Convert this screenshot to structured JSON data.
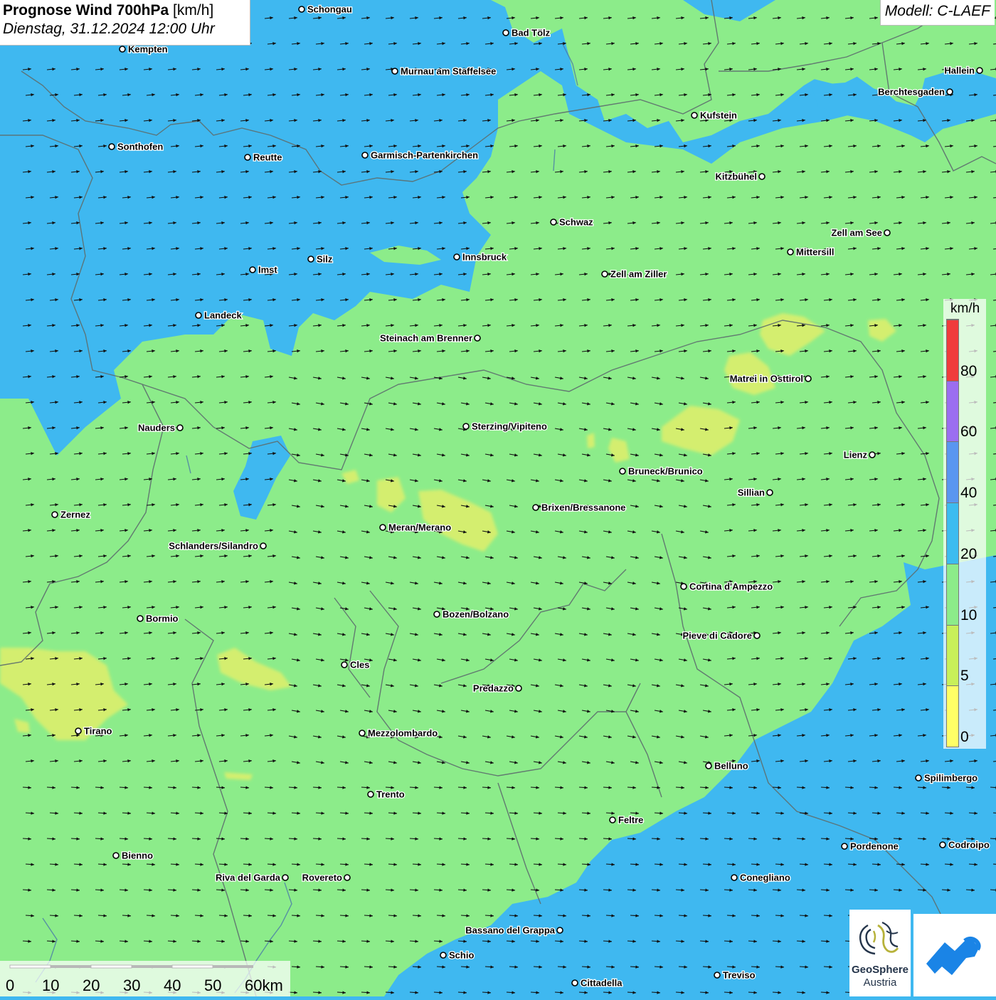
{
  "header": {
    "title_main": "Prognose Wind 700hPa",
    "title_unit": "[km/h]",
    "subtitle": "Dienstag, 31.12.2024 12:00 Uhr",
    "model": "Modell: C-LAEF"
  },
  "legend": {
    "unit": "km/h",
    "labels": [
      "0",
      "5",
      "10",
      "20",
      "40",
      "60",
      "80"
    ],
    "bins": [
      {
        "color": "#ffff66"
      },
      {
        "color": "#c8f05a"
      },
      {
        "color": "#8cec8a"
      },
      {
        "color": "#3cbcf0"
      },
      {
        "color": "#5a96f0"
      },
      {
        "color": "#9b6ef0"
      },
      {
        "color": "#f03c3c"
      }
    ]
  },
  "scalebar": {
    "labels": [
      "0",
      "10",
      "20",
      "30",
      "40",
      "50",
      "60km"
    ]
  },
  "map": {
    "colors": {
      "green": "#8cec8a",
      "blue": "#3fb8f0",
      "yellow": "#d8ef6e",
      "arrow": "#111111",
      "border": "#5d6e6e"
    },
    "wind_direction": "east",
    "cities": [
      {
        "name": "Schongau",
        "side": "right"
      },
      {
        "name": "Bad Tölz",
        "side": "right"
      },
      {
        "name": "Kempten",
        "side": "right"
      },
      {
        "name": "Murnau am Staffelsee",
        "side": "right"
      },
      {
        "name": "Hallein",
        "side": "left"
      },
      {
        "name": "Berchtesgaden",
        "side": "left"
      },
      {
        "name": "Kufstein",
        "side": "right"
      },
      {
        "name": "Sonthofen",
        "side": "right"
      },
      {
        "name": "Reutte",
        "side": "right"
      },
      {
        "name": "Garmisch-Partenkirchen",
        "side": "right"
      },
      {
        "name": "Kitzbühel",
        "side": "left"
      },
      {
        "name": "Schwaz",
        "side": "right"
      },
      {
        "name": "Zell am See",
        "side": "left"
      },
      {
        "name": "Mittersill",
        "side": "right"
      },
      {
        "name": "Innsbruck",
        "side": "right"
      },
      {
        "name": "Silz",
        "side": "right"
      },
      {
        "name": "Imst",
        "side": "right"
      },
      {
        "name": "Zell am Ziller",
        "side": "right"
      },
      {
        "name": "Landeck",
        "side": "right"
      },
      {
        "name": "Steinach am Brenner",
        "side": "left"
      },
      {
        "name": "Matrei in Osttirol",
        "side": "left"
      },
      {
        "name": "Nauders",
        "side": "left"
      },
      {
        "name": "Sterzing/Vipiteno",
        "side": "right"
      },
      {
        "name": "Lienz",
        "side": "left"
      },
      {
        "name": "Bruneck/Brunico",
        "side": "right"
      },
      {
        "name": "Sillian",
        "side": "left"
      },
      {
        "name": "Brixen/Bressanone",
        "side": "right"
      },
      {
        "name": "Zernez",
        "side": "right"
      },
      {
        "name": "Meran/Merano",
        "side": "right"
      },
      {
        "name": "Schlanders/Silandro",
        "side": "left"
      },
      {
        "name": "Cortina d'Ampezzo",
        "side": "right"
      },
      {
        "name": "Bozen/Bolzano",
        "side": "right"
      },
      {
        "name": "Bormio",
        "side": "right"
      },
      {
        "name": "Pieve di Cadore",
        "side": "left"
      },
      {
        "name": "Cles",
        "side": "right"
      },
      {
        "name": "Predazzo",
        "side": "left"
      },
      {
        "name": "Tirano",
        "side": "right"
      },
      {
        "name": "Mezzolombardo",
        "side": "right"
      },
      {
        "name": "Belluno",
        "side": "right"
      },
      {
        "name": "Spilimbergo",
        "side": "right"
      },
      {
        "name": "Trento",
        "side": "right"
      },
      {
        "name": "Feltre",
        "side": "right"
      },
      {
        "name": "Pordenone",
        "side": "right"
      },
      {
        "name": "Codroipo",
        "side": "right"
      },
      {
        "name": "Bienno",
        "side": "right"
      },
      {
        "name": "Riva del Garda",
        "side": "left"
      },
      {
        "name": "Rovereto",
        "side": "left"
      },
      {
        "name": "Conegliano",
        "side": "right"
      },
      {
        "name": "Bassano del Grappa",
        "side": "left"
      },
      {
        "name": "Schio",
        "side": "right"
      },
      {
        "name": "Treviso",
        "side": "right"
      },
      {
        "name": "Cittadella",
        "side": "right"
      }
    ]
  },
  "logos": {
    "geosphere_line1": "GeoSphere",
    "geosphere_line2": "Austria"
  }
}
